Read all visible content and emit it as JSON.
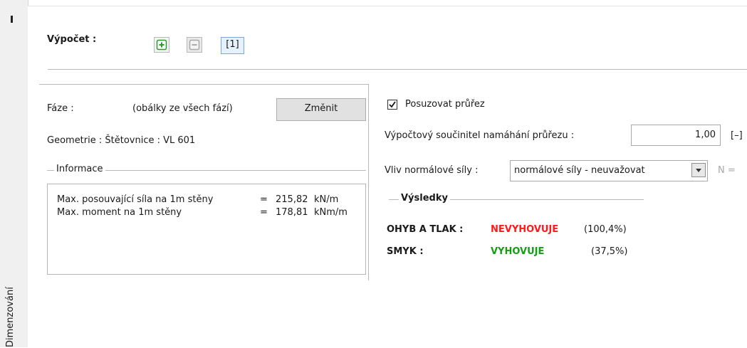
{
  "side_tab": {
    "label": "Dimenzování"
  },
  "calc": {
    "label": "Výpočet :",
    "add_icon": "plus-square-icon",
    "remove_icon": "minus-square-icon",
    "stage_label": "[1]"
  },
  "left": {
    "phase_label": "Fáze :",
    "phase_value": "(obálky ze všech fází)",
    "change_button": "Změnit",
    "geometry": "Geometrie : Štětovnice : VL 601",
    "info_group": "Informace",
    "info_rows": [
      {
        "label": "Max. posouvající síla na 1m stěny",
        "eq": "=",
        "value": "215,82",
        "unit": "kN/m"
      },
      {
        "label": "Max. moment na 1m stěny",
        "eq": "=",
        "value": "178,81",
        "unit": "kNm/m"
      }
    ]
  },
  "right": {
    "check_label": "Posuzovat průřez",
    "check_checked": true,
    "coef_label": "Výpočtový součinitel namáhání průřezu :",
    "coef_value": "1,00",
    "coef_unit": "[–]",
    "normal_label": "Vliv normálové síly :",
    "normal_value": "normálové síly - neuvažovat",
    "n_label": "N =",
    "results_group": "Výsledky",
    "results": [
      {
        "label": "OHYB A TLAK :",
        "status": "NEVYHOVUJE",
        "percent": "(100,4%)",
        "status_color": "#ff1a1a"
      },
      {
        "label": "SMYK :",
        "status": "VYHOVUJE",
        "percent": "(37,5%)",
        "status_color": "#11a011"
      }
    ]
  },
  "colors": {
    "ok": "#11a011",
    "fail": "#ff1a1a",
    "stage_border": "#7aa7d8"
  }
}
